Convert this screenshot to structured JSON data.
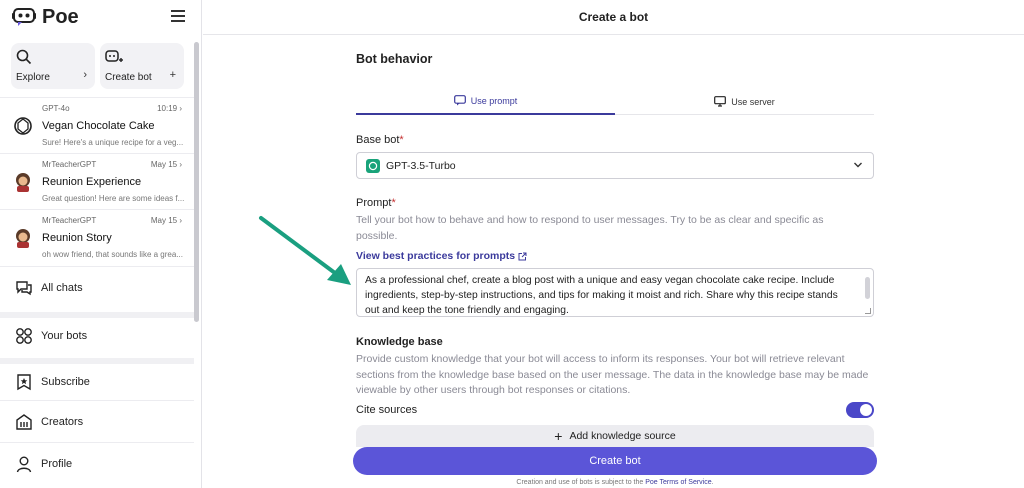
{
  "app": {
    "brand": "Poe"
  },
  "header": {
    "title": "Create a bot"
  },
  "sidebar": {
    "explore": {
      "label": "Explore",
      "aux": "›"
    },
    "create_bot": {
      "label": "Create bot",
      "aux": "+"
    },
    "chats": [
      {
        "bot": "GPT-4o",
        "time": "10:19 ›",
        "title": "Vegan Chocolate Cake",
        "preview": "Sure! Here's a unique recipe for a veg..."
      },
      {
        "bot": "MrTeacherGPT",
        "time": "May 15 ›",
        "title": "Reunion Experience",
        "preview": "Great question! Here are some ideas f..."
      },
      {
        "bot": "MrTeacherGPT",
        "time": "May 15 ›",
        "title": "Reunion Story",
        "preview": "oh wow friend, that sounds like a grea..."
      }
    ],
    "nav": {
      "all_chats": "All chats",
      "your_bots": "Your bots",
      "subscribe": "Subscribe",
      "creators": "Creators",
      "profile": "Profile"
    }
  },
  "main": {
    "section_title": "Bot behavior",
    "tabs": {
      "prompt": "Use prompt",
      "server": "Use server"
    },
    "base_bot": {
      "label": "Base bot",
      "required": "*",
      "value": "GPT-3.5-Turbo"
    },
    "prompt": {
      "label": "Prompt",
      "required": "*",
      "help": "Tell your bot how to behave and how to respond to user messages. Try to be as clear and specific as possible.",
      "link": "View best practices for prompts",
      "value": "As a professional chef, create a blog post with a unique and easy vegan chocolate cake recipe. Include ingredients, step-by-step instructions, and tips for making it moist and rich. Share why this recipe stands out and keep the tone friendly and engaging."
    },
    "knowledge": {
      "label": "Knowledge base",
      "help": "Provide custom knowledge that your bot will access to inform its responses. Your bot will retrieve relevant sections from the knowledge base based on the user message. The data in the knowledge base may be made viewable by other users through bot responses or citations.",
      "cite_label": "Cite sources",
      "cite_enabled": true,
      "add_label": "Add knowledge source"
    },
    "create_label": "Create bot",
    "terms": {
      "text": "Creation and use of bots is subject to the ",
      "link": "Poe Terms of Service",
      "end": "."
    }
  },
  "colors": {
    "accent": "#5b55d8",
    "tab_active": "#3b3a9c",
    "arrow": "#1a9f80",
    "required": "#c53030"
  }
}
